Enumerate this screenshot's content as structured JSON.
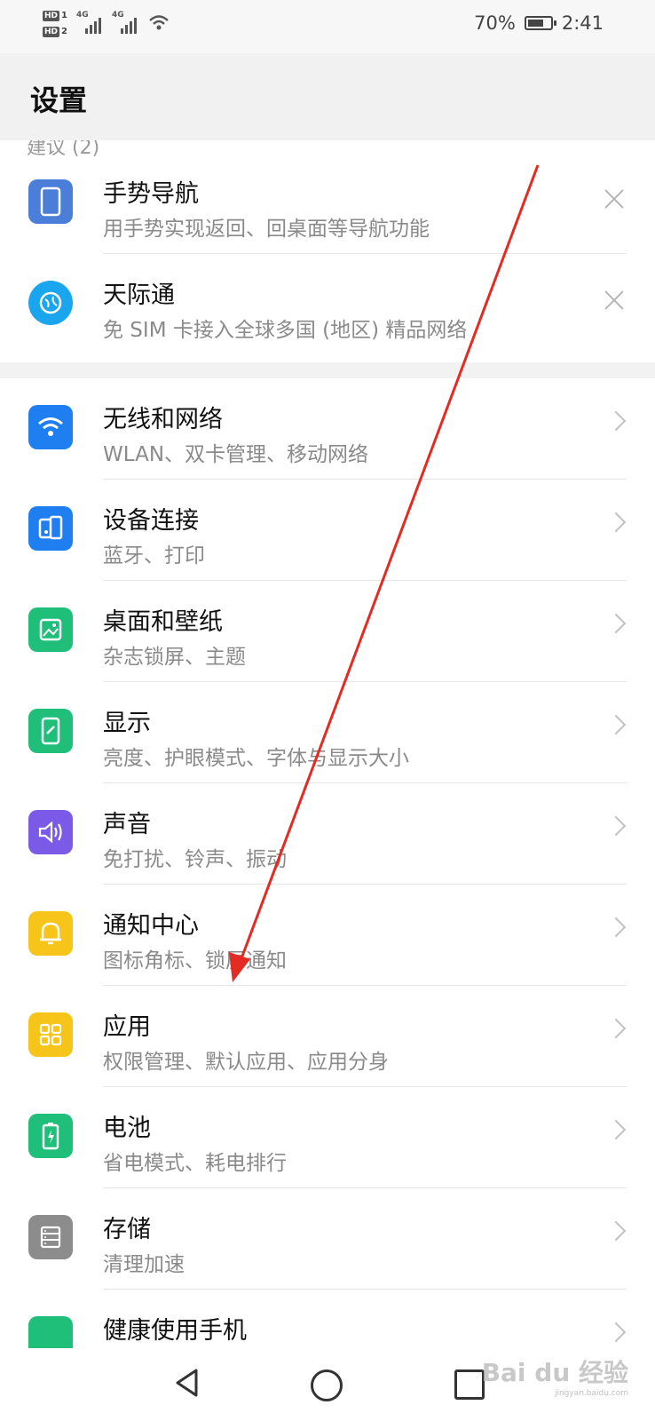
{
  "status_bar": {
    "sim1_label": "HD",
    "sim1_num": "1",
    "sim2_label": "HD",
    "sim2_num": "2",
    "net1": "4G",
    "net2": "4G",
    "battery_percent_text": "70%",
    "battery_level": 0.7,
    "time": "2:41"
  },
  "header": {
    "title": "设置"
  },
  "section_hint": "建议 (2)",
  "suggestions": [
    {
      "title": "手势导航",
      "subtitle": "用手势实现返回、回桌面等导航功能",
      "icon": "gesture-nav-icon",
      "color": "#4a7ed9"
    },
    {
      "title": "天际通",
      "subtitle": "免 SIM 卡接入全球多国 (地区) 精品网络",
      "icon": "globe-icon",
      "color": "#1aa6ee"
    }
  ],
  "settings": [
    {
      "title": "无线和网络",
      "subtitle": "WLAN、双卡管理、移动网络",
      "icon": "wifi-icon",
      "color": "#1f7ef0"
    },
    {
      "title": "设备连接",
      "subtitle": "蓝牙、打印",
      "icon": "device-connect-icon",
      "color": "#1f7ef0"
    },
    {
      "title": "桌面和壁纸",
      "subtitle": "杂志锁屏、主题",
      "icon": "wallpaper-icon",
      "color": "#1fbf7a"
    },
    {
      "title": "显示",
      "subtitle": "亮度、护眼模式、字体与显示大小",
      "icon": "display-icon",
      "color": "#1fbf7a"
    },
    {
      "title": "声音",
      "subtitle": "免打扰、铃声、振动",
      "icon": "sound-icon",
      "color": "#7b5ae8"
    },
    {
      "title": "通知中心",
      "subtitle": "图标角标、锁屏通知",
      "icon": "bell-icon",
      "color": "#f7c51a"
    },
    {
      "title": "应用",
      "subtitle": "权限管理、默认应用、应用分身",
      "icon": "apps-icon",
      "color": "#f7c51a"
    },
    {
      "title": "电池",
      "subtitle": "省电模式、耗电排行",
      "icon": "battery-icon",
      "color": "#1fbf7a"
    },
    {
      "title": "存储",
      "subtitle": "清理加速",
      "icon": "storage-icon",
      "color": "#8c8c8c"
    },
    {
      "title": "健康使用手机",
      "subtitle": "",
      "icon": "health-icon",
      "color": "#1fbf7a"
    }
  ],
  "watermark": {
    "text": "Bai du 经验",
    "sub": "jingyan.baidu.com"
  }
}
